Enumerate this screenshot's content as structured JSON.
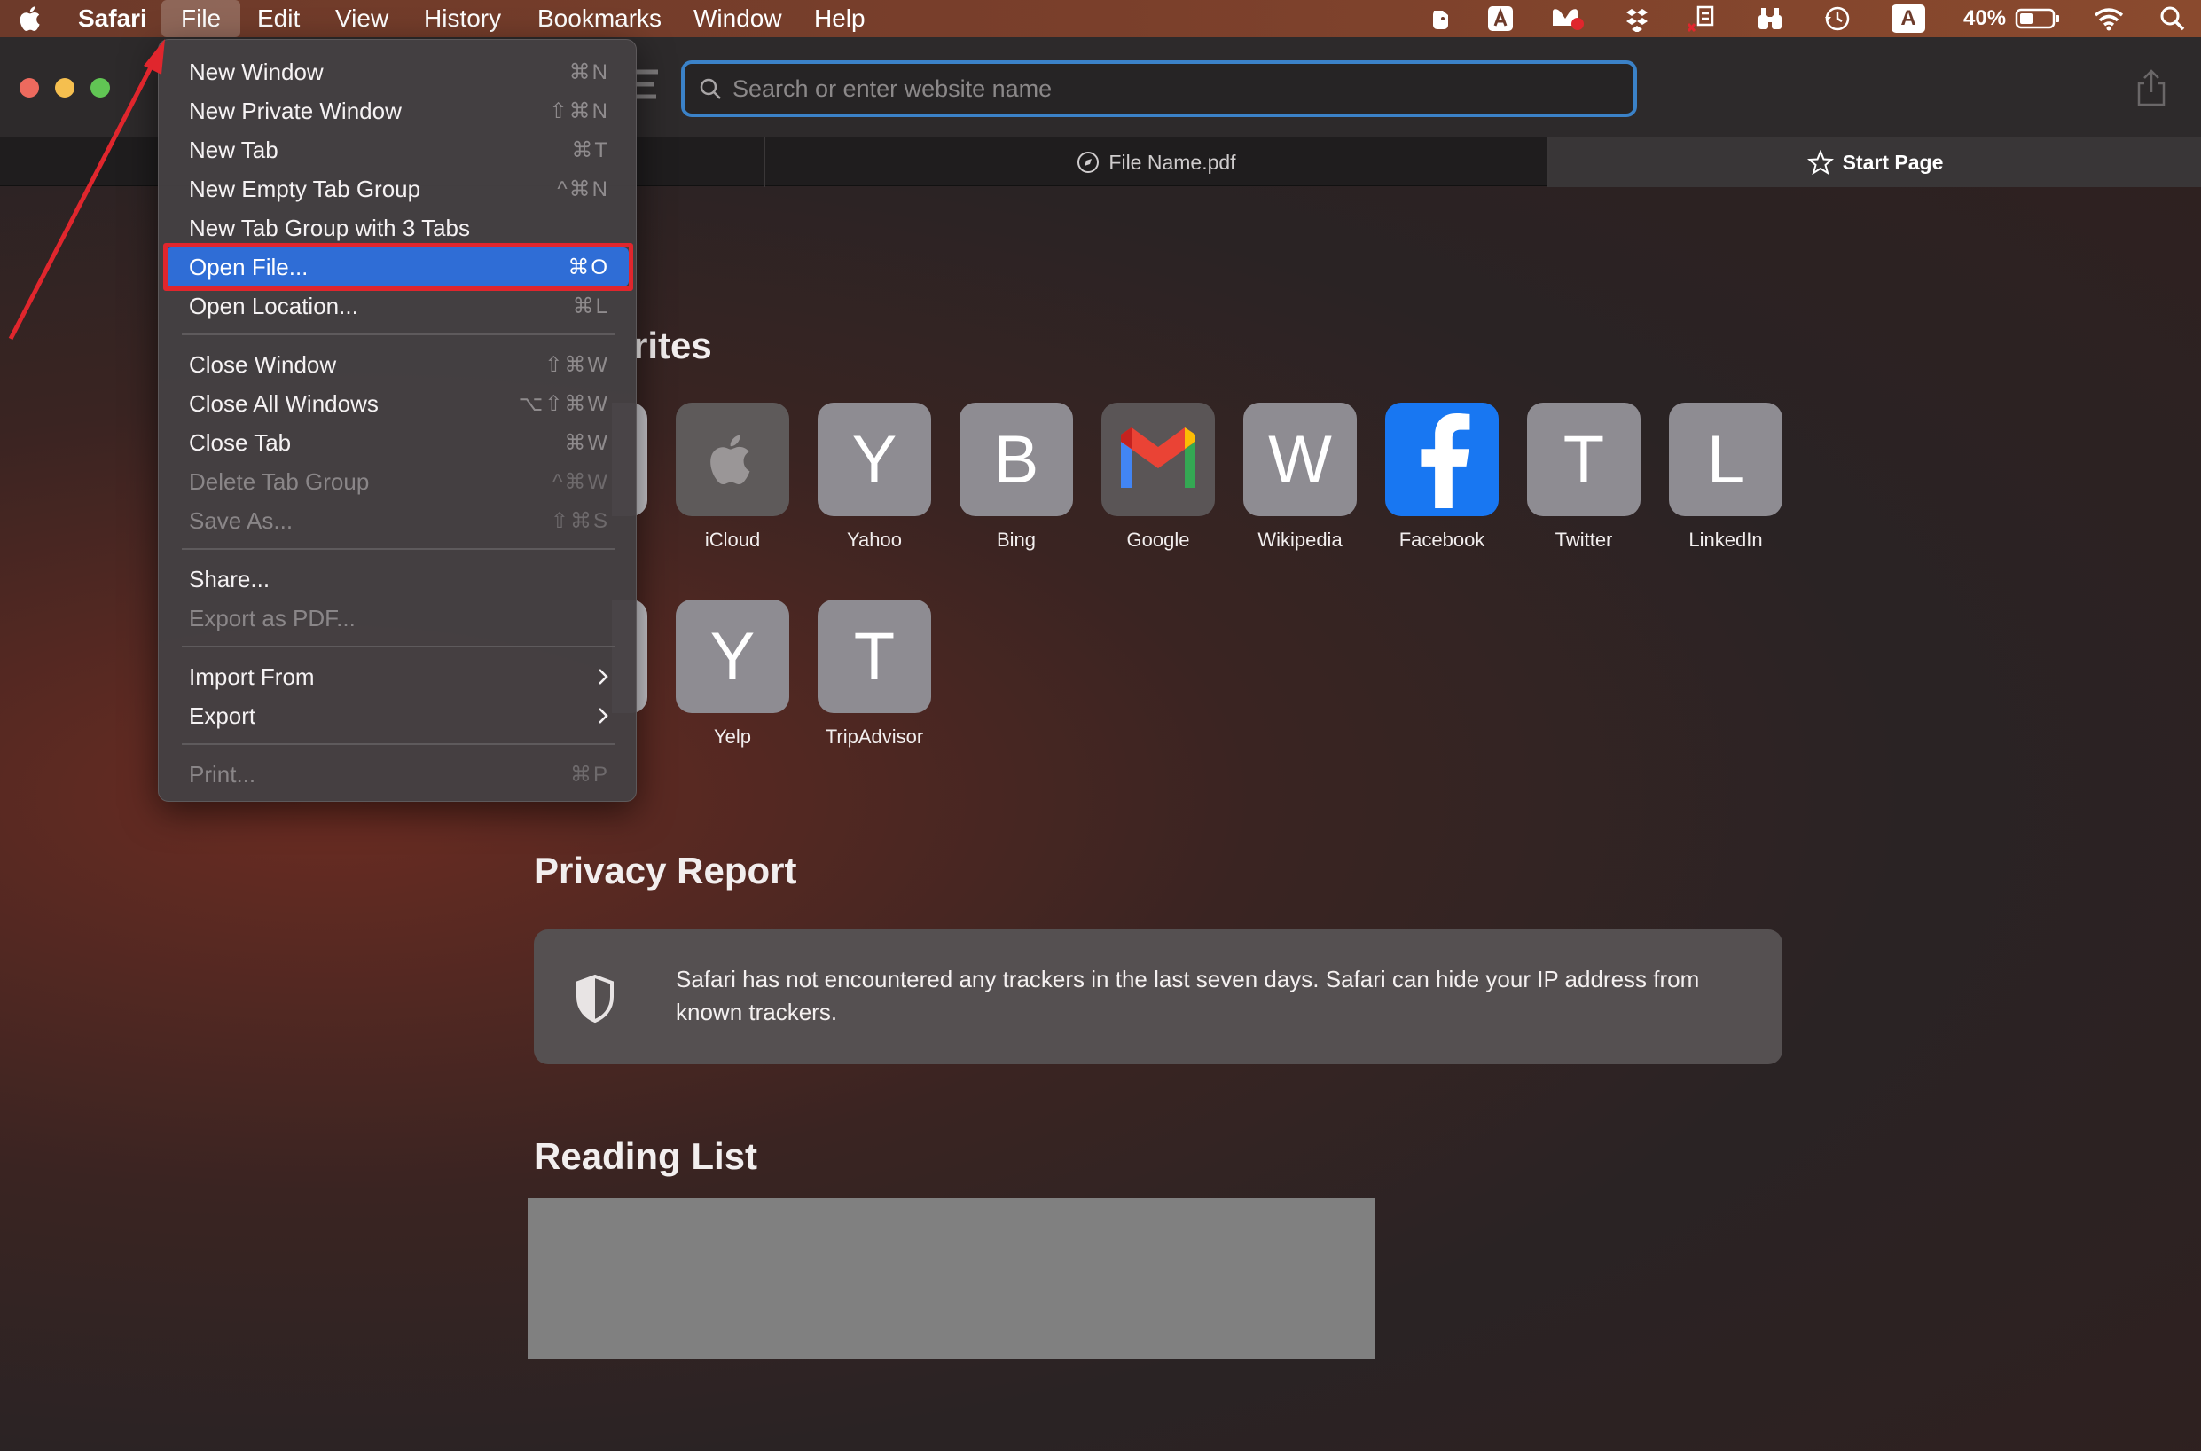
{
  "menubar": {
    "app_name": "Safari",
    "items": [
      "File",
      "Edit",
      "View",
      "History",
      "Bookmarks",
      "Window",
      "Help"
    ],
    "active_item": "File",
    "battery_percent": "40%",
    "input_source": "A"
  },
  "toolbar": {
    "search_placeholder": "Search or enter website name"
  },
  "tabs": [
    {
      "label": ""
    },
    {
      "label": "File Name.pdf"
    },
    {
      "label": "Start Page"
    }
  ],
  "start_page": {
    "favorites_title_partial": "rites",
    "favorites_row1": [
      {
        "label": "iCloud",
        "letter": ""
      },
      {
        "label": "Yahoo",
        "letter": "Y"
      },
      {
        "label": "Bing",
        "letter": "B"
      },
      {
        "label": "Google",
        "letter": ""
      },
      {
        "label": "Wikipedia",
        "letter": "W"
      },
      {
        "label": "Facebook",
        "letter": ""
      },
      {
        "label": "Twitter",
        "letter": "T"
      },
      {
        "label": "LinkedIn",
        "letter": "L"
      }
    ],
    "favorites_row2": [
      {
        "label": "Yelp",
        "letter": "Y"
      },
      {
        "label": "TripAdvisor",
        "letter": "T"
      }
    ],
    "privacy_title": "Privacy Report",
    "privacy_text": "Safari has not encountered any trackers in the last seven days. Safari can hide your IP address from known trackers.",
    "reading_list_title": "Reading List"
  },
  "file_menu": {
    "items": [
      {
        "label": "New Window",
        "shortcut": "⌘N"
      },
      {
        "label": "New Private Window",
        "shortcut": "⇧⌘N"
      },
      {
        "label": "New Tab",
        "shortcut": "⌘T"
      },
      {
        "label": "New Empty Tab Group",
        "shortcut": "^⌘N"
      },
      {
        "label": "New Tab Group with 3 Tabs",
        "shortcut": ""
      },
      {
        "label": "Open File...",
        "shortcut": "⌘O",
        "highlighted": true
      },
      {
        "label": "Open Location...",
        "shortcut": "⌘L"
      },
      {
        "label": "Close Window",
        "shortcut": "⇧⌘W"
      },
      {
        "label": "Close All Windows",
        "shortcut": "⌥⇧⌘W"
      },
      {
        "label": "Close Tab",
        "shortcut": "⌘W"
      },
      {
        "label": "Delete Tab Group",
        "shortcut": "^⌘W",
        "disabled": true
      },
      {
        "label": "Save As...",
        "shortcut": "⇧⌘S",
        "disabled": true
      },
      {
        "label": "Share...",
        "shortcut": ""
      },
      {
        "label": "Export as PDF...",
        "shortcut": "",
        "disabled": true
      },
      {
        "label": "Import From",
        "shortcut": "",
        "submenu": true
      },
      {
        "label": "Export",
        "shortcut": "",
        "submenu": true
      },
      {
        "label": "Print...",
        "shortcut": "⌘P",
        "disabled": true
      }
    ]
  },
  "colors": {
    "highlight": "#2f6dd6",
    "annotation_red": "#e0262d",
    "facebook_blue": "#1877f2",
    "search_focus": "#3b82c8"
  }
}
